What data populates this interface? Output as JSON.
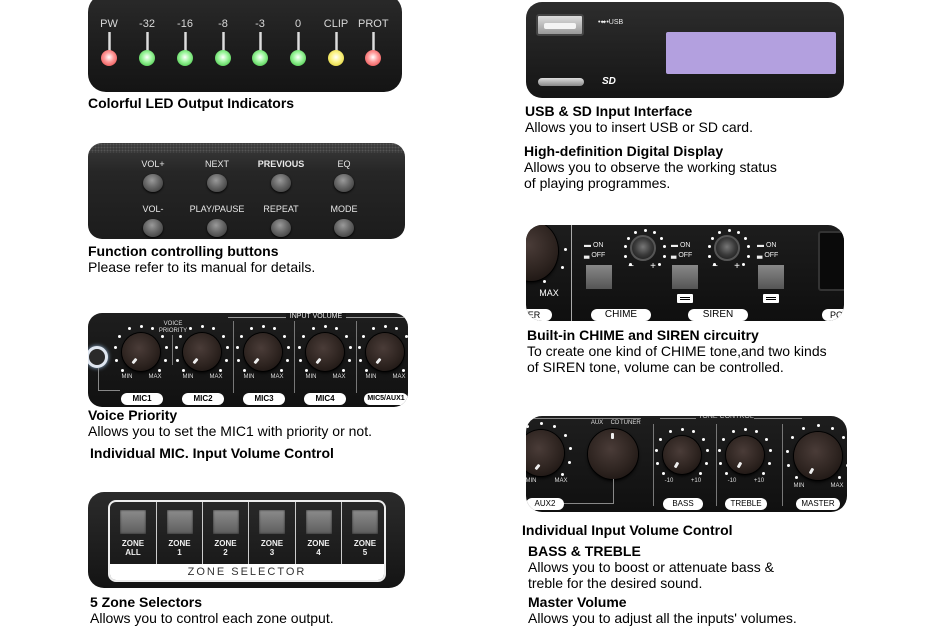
{
  "led_section": {
    "indicators": [
      {
        "label": "PW",
        "color": "#ff6b6b"
      },
      {
        "label": "-32",
        "color": "#4cdc4c"
      },
      {
        "label": "-16",
        "color": "#4cdc4c"
      },
      {
        "label": "-8",
        "color": "#4cdc4c"
      },
      {
        "label": "-3",
        "color": "#4cdc4c"
      },
      {
        "label": "0",
        "color": "#4cdc4c"
      },
      {
        "label": "CLIP",
        "color": "#f5ef4a"
      },
      {
        "label": "PROT",
        "color": "#ff6b6b"
      }
    ],
    "title": "Colorful LED Output Indicators"
  },
  "function_section": {
    "buttons": [
      {
        "label": "VOL+"
      },
      {
        "label": "NEXT"
      },
      {
        "label": "PREVIOUS"
      },
      {
        "label": "EQ"
      },
      {
        "label": "VOL-"
      },
      {
        "label": "PLAY/PAUSE"
      },
      {
        "label": "REPEAT"
      },
      {
        "label": "MODE"
      }
    ],
    "title": "Function controlling buttons",
    "text": "Please refer to its manual for details."
  },
  "mic_section": {
    "header": "INPUT VOLUME",
    "voice_priority_label": "VOICE PRIORITY",
    "min_label": "MIN",
    "max_label": "MAX",
    "channels": [
      {
        "label": "MIC1"
      },
      {
        "label": "MIC2"
      },
      {
        "label": "MIC3"
      },
      {
        "label": "MIC4"
      },
      {
        "label": "MIC5/AUX1"
      }
    ],
    "voice_title": "Voice Priority",
    "voice_text": "Allows you to set the MIC1 with priority or not.",
    "volume_title": "Individual MIC. Input Volume Control"
  },
  "zone_section": {
    "zones": [
      {
        "line1": "ZONE",
        "line2": "ALL"
      },
      {
        "line1": "ZONE",
        "line2": "1"
      },
      {
        "line1": "ZONE",
        "line2": "2"
      },
      {
        "line1": "ZONE",
        "line2": "3"
      },
      {
        "line1": "ZONE",
        "line2": "4"
      },
      {
        "line1": "ZONE",
        "line2": "5"
      }
    ],
    "footer": "ZONE SELECTOR",
    "title": "5 Zone Selectors",
    "text": "Allows you to control each zone output."
  },
  "usb_section": {
    "usb_label": "•⬌•USB",
    "sd_label": "SD",
    "display_color": "#b3a0df",
    "usb_title": "USB & SD Input Interface",
    "usb_text": "Allows you to insert USB or SD card.",
    "display_title": "High-definition Digital Display",
    "display_text_1": "Allows you to observe the working status",
    "display_text_2": "of playing programmes."
  },
  "chime_section": {
    "max_label": "MAX",
    "on_label": "ON",
    "off_label": "OFF",
    "minus": "−",
    "plus": "+",
    "chime_label": "CHIME",
    "siren_label": "SIREN",
    "left_cut_label": "ER",
    "right_cut_label": "PC",
    "title": "Built-in CHIME and SIREN circuitry",
    "text_1": "To create one kind of CHIME tone,and two kinds",
    "text_2": "of SIREN tone, volume can be controlled."
  },
  "tone_section": {
    "header": "TONE CONTROL",
    "selector_labels": [
      "AUX",
      "CD",
      "TUNER"
    ],
    "aux2_label": "AUX2",
    "bass_label": "BASS",
    "treble_label": "TREBLE",
    "master_label": "MASTER",
    "min_label": "MIN",
    "max_label": "MAX",
    "minus10": "-10",
    "plus10": "+10",
    "title": "Individual Input Volume Control",
    "bt_title": "BASS & TREBLE",
    "bt_text_1": "Allows you to boost or attenuate bass &",
    "bt_text_2": "treble for the desired sound.",
    "master_title": "Master Volume",
    "master_text": "Allows you to adjust all the inputs' volumes."
  }
}
